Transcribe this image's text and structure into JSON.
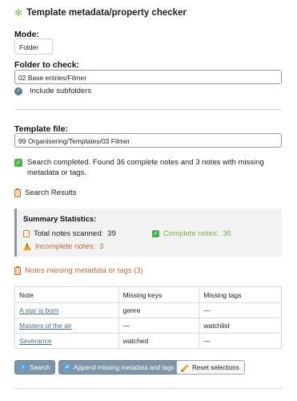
{
  "header": {
    "title": "Template metadata/property checker",
    "icon": "gear-icon"
  },
  "mode": {
    "label": "Mode:",
    "value": "Folder"
  },
  "folder": {
    "label": "Folder to check:",
    "value": "02 Base entries/Filmer"
  },
  "include_subfolders": {
    "label": "Include subfolders",
    "checked": true
  },
  "template": {
    "label": "Template file:",
    "value": "99 Organisering/Templates/03 Filmer"
  },
  "status": {
    "message": "Search completed. Found 36 complete notes and 3 notes with missing metadata or tags."
  },
  "results": {
    "heading": "Search Results"
  },
  "summary": {
    "title": "Summary Statistics:",
    "total_label": "Total notes scanned:",
    "total_value": "39",
    "complete_label": "Complete notes:",
    "complete_value": "36",
    "incomplete_label": "Incomplete notes:",
    "incomplete_value": "3"
  },
  "missing": {
    "heading": "Notes missing metadata or tags (3)",
    "columns": [
      "Note",
      "Missing keys",
      "Missing tags"
    ],
    "rows": [
      {
        "note": "A star is born",
        "keys": "genre",
        "tags": "—"
      },
      {
        "note": "Masters of the air",
        "keys": "—",
        "tags": "watchlist"
      },
      {
        "note": "Severance",
        "keys": "watched",
        "tags": "—"
      }
    ]
  },
  "buttons": {
    "search": "Search",
    "append": "Append missing metadata and tags",
    "reset": "Reset selections"
  },
  "colors": {
    "accent": "#7d95a8",
    "success": "#4caf50",
    "warning": "#f0a020",
    "missing_heading": "#c2693a",
    "link": "#4a6c8c"
  }
}
